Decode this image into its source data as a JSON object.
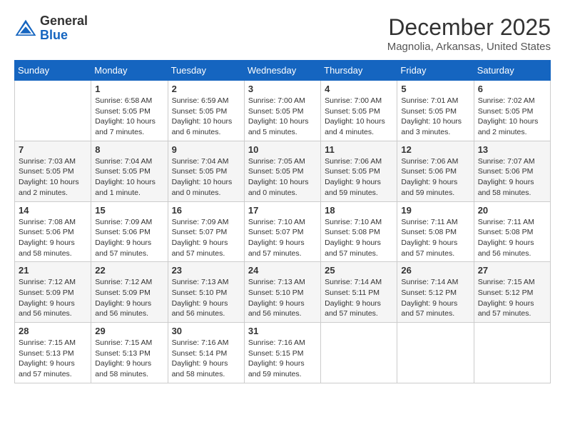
{
  "header": {
    "logo_general": "General",
    "logo_blue": "Blue",
    "month_title": "December 2025",
    "location": "Magnolia, Arkansas, United States"
  },
  "days_of_week": [
    "Sunday",
    "Monday",
    "Tuesday",
    "Wednesday",
    "Thursday",
    "Friday",
    "Saturday"
  ],
  "weeks": [
    [
      {
        "day": "",
        "info": ""
      },
      {
        "day": "1",
        "info": "Sunrise: 6:58 AM\nSunset: 5:05 PM\nDaylight: 10 hours\nand 7 minutes."
      },
      {
        "day": "2",
        "info": "Sunrise: 6:59 AM\nSunset: 5:05 PM\nDaylight: 10 hours\nand 6 minutes."
      },
      {
        "day": "3",
        "info": "Sunrise: 7:00 AM\nSunset: 5:05 PM\nDaylight: 10 hours\nand 5 minutes."
      },
      {
        "day": "4",
        "info": "Sunrise: 7:00 AM\nSunset: 5:05 PM\nDaylight: 10 hours\nand 4 minutes."
      },
      {
        "day": "5",
        "info": "Sunrise: 7:01 AM\nSunset: 5:05 PM\nDaylight: 10 hours\nand 3 minutes."
      },
      {
        "day": "6",
        "info": "Sunrise: 7:02 AM\nSunset: 5:05 PM\nDaylight: 10 hours\nand 2 minutes."
      }
    ],
    [
      {
        "day": "7",
        "info": "Sunrise: 7:03 AM\nSunset: 5:05 PM\nDaylight: 10 hours\nand 2 minutes."
      },
      {
        "day": "8",
        "info": "Sunrise: 7:04 AM\nSunset: 5:05 PM\nDaylight: 10 hours\nand 1 minute."
      },
      {
        "day": "9",
        "info": "Sunrise: 7:04 AM\nSunset: 5:05 PM\nDaylight: 10 hours\nand 0 minutes."
      },
      {
        "day": "10",
        "info": "Sunrise: 7:05 AM\nSunset: 5:05 PM\nDaylight: 10 hours\nand 0 minutes."
      },
      {
        "day": "11",
        "info": "Sunrise: 7:06 AM\nSunset: 5:05 PM\nDaylight: 9 hours\nand 59 minutes."
      },
      {
        "day": "12",
        "info": "Sunrise: 7:06 AM\nSunset: 5:06 PM\nDaylight: 9 hours\nand 59 minutes."
      },
      {
        "day": "13",
        "info": "Sunrise: 7:07 AM\nSunset: 5:06 PM\nDaylight: 9 hours\nand 58 minutes."
      }
    ],
    [
      {
        "day": "14",
        "info": "Sunrise: 7:08 AM\nSunset: 5:06 PM\nDaylight: 9 hours\nand 58 minutes."
      },
      {
        "day": "15",
        "info": "Sunrise: 7:09 AM\nSunset: 5:06 PM\nDaylight: 9 hours\nand 57 minutes."
      },
      {
        "day": "16",
        "info": "Sunrise: 7:09 AM\nSunset: 5:07 PM\nDaylight: 9 hours\nand 57 minutes."
      },
      {
        "day": "17",
        "info": "Sunrise: 7:10 AM\nSunset: 5:07 PM\nDaylight: 9 hours\nand 57 minutes."
      },
      {
        "day": "18",
        "info": "Sunrise: 7:10 AM\nSunset: 5:08 PM\nDaylight: 9 hours\nand 57 minutes."
      },
      {
        "day": "19",
        "info": "Sunrise: 7:11 AM\nSunset: 5:08 PM\nDaylight: 9 hours\nand 57 minutes."
      },
      {
        "day": "20",
        "info": "Sunrise: 7:11 AM\nSunset: 5:08 PM\nDaylight: 9 hours\nand 56 minutes."
      }
    ],
    [
      {
        "day": "21",
        "info": "Sunrise: 7:12 AM\nSunset: 5:09 PM\nDaylight: 9 hours\nand 56 minutes."
      },
      {
        "day": "22",
        "info": "Sunrise: 7:12 AM\nSunset: 5:09 PM\nDaylight: 9 hours\nand 56 minutes."
      },
      {
        "day": "23",
        "info": "Sunrise: 7:13 AM\nSunset: 5:10 PM\nDaylight: 9 hours\nand 56 minutes."
      },
      {
        "day": "24",
        "info": "Sunrise: 7:13 AM\nSunset: 5:10 PM\nDaylight: 9 hours\nand 56 minutes."
      },
      {
        "day": "25",
        "info": "Sunrise: 7:14 AM\nSunset: 5:11 PM\nDaylight: 9 hours\nand 57 minutes."
      },
      {
        "day": "26",
        "info": "Sunrise: 7:14 AM\nSunset: 5:12 PM\nDaylight: 9 hours\nand 57 minutes."
      },
      {
        "day": "27",
        "info": "Sunrise: 7:15 AM\nSunset: 5:12 PM\nDaylight: 9 hours\nand 57 minutes."
      }
    ],
    [
      {
        "day": "28",
        "info": "Sunrise: 7:15 AM\nSunset: 5:13 PM\nDaylight: 9 hours\nand 57 minutes."
      },
      {
        "day": "29",
        "info": "Sunrise: 7:15 AM\nSunset: 5:13 PM\nDaylight: 9 hours\nand 58 minutes."
      },
      {
        "day": "30",
        "info": "Sunrise: 7:16 AM\nSunset: 5:14 PM\nDaylight: 9 hours\nand 58 minutes."
      },
      {
        "day": "31",
        "info": "Sunrise: 7:16 AM\nSunset: 5:15 PM\nDaylight: 9 hours\nand 59 minutes."
      },
      {
        "day": "",
        "info": ""
      },
      {
        "day": "",
        "info": ""
      },
      {
        "day": "",
        "info": ""
      }
    ]
  ]
}
